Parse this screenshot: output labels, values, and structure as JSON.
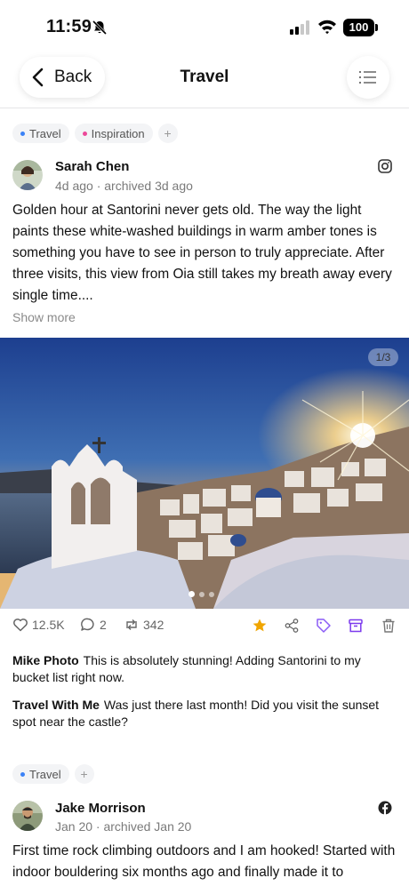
{
  "status_bar": {
    "time": "11:59",
    "battery": "100"
  },
  "header": {
    "back_label": "Back",
    "title": "Travel"
  },
  "posts": [
    {
      "tags": [
        {
          "label": "Travel",
          "color": "#3b82f6"
        },
        {
          "label": "Inspiration",
          "color": "#ec4899"
        }
      ],
      "author": "Sarah Chen",
      "meta": "4d ago · archived 3d ago",
      "source_icon": "instagram-icon",
      "text": "Golden hour at Santorini never gets old. The way the light paints these white-washed buildings in warm amber tones is something you have to see in person to truly appreciate. After three visits, this view from Oia still takes my breath away every single time....",
      "show_more": "Show more",
      "image_counter": "1/3",
      "image_total": 3,
      "image_index": 1,
      "stats": {
        "likes": "12.5K",
        "comments": "2",
        "reposts": "342"
      },
      "comments": [
        {
          "author": "Mike Photo",
          "text": "This is absolutely stunning! Adding Santorini to my bucket list right now."
        },
        {
          "author": "Travel With Me",
          "text": "Was just there last month! Did you visit the sunset spot near the castle?"
        }
      ]
    },
    {
      "tags": [
        {
          "label": "Travel",
          "color": "#3b82f6"
        }
      ],
      "author": "Jake Morrison",
      "meta": "Jan 20 · archived Jan 20",
      "source_icon": "facebook-icon",
      "text": "First time rock climbing outdoors and I am hooked! Started with indoor bouldering six months ago and finally made it to"
    }
  ],
  "colors": {
    "star": "#f0a500",
    "tag_purple": "#8b5cf6",
    "archive_purple": "#7c3aed"
  }
}
